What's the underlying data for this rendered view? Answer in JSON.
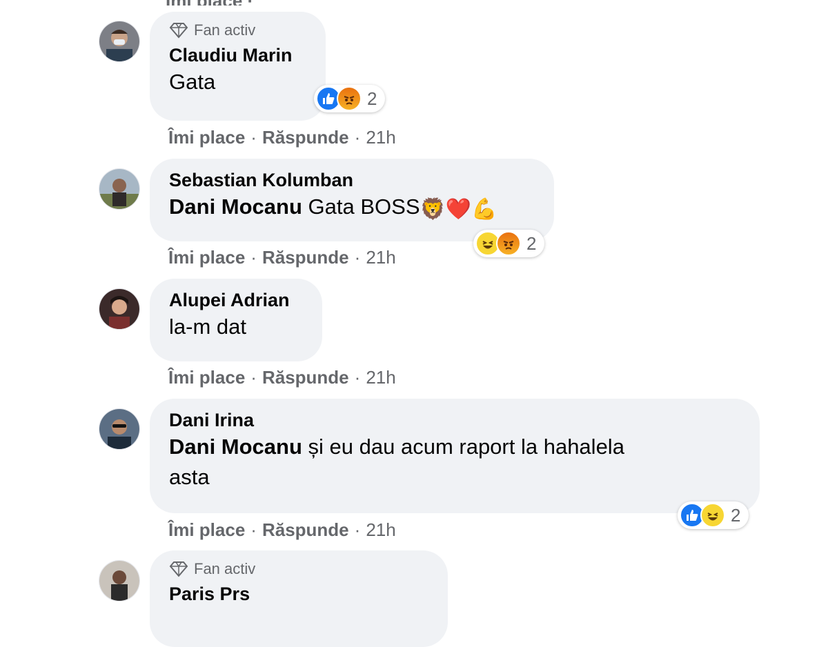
{
  "top_cut_text": "Îmi place · Răspunde",
  "action_labels": {
    "like": "Îmi place",
    "reply": "Răspunde",
    "separator": "·"
  },
  "comments": [
    {
      "author": "Claudiu Marin",
      "badge": "Fan activ",
      "text": "Gata",
      "reactions": {
        "types": [
          "like-icon",
          "angry-icon"
        ],
        "count": "2"
      },
      "time": "21h"
    },
    {
      "author": "Sebastian Kolumban",
      "mention": "Dani Mocanu",
      "text": "Gata BOSS",
      "emojis": "🦁❤️💪",
      "reactions": {
        "types": [
          "haha-icon",
          "angry-icon"
        ],
        "count": "2"
      },
      "time": "21h"
    },
    {
      "author": "Alupei Adrian",
      "text": "la-m dat",
      "time": "21h"
    },
    {
      "author": "Dani Irina",
      "mention": "Dani Mocanu",
      "text_line1": "și eu dau acum raport la hahalela",
      "text_line2": "asta",
      "reactions": {
        "types": [
          "like-icon",
          "haha-icon"
        ],
        "count": "2"
      },
      "time": "21h"
    },
    {
      "author": "Paris Prs",
      "badge": "Fan activ"
    }
  ],
  "colors": {
    "bubble": "#f0f2f5",
    "secondary_text": "#65676b",
    "like_blue": "#1877f2"
  }
}
